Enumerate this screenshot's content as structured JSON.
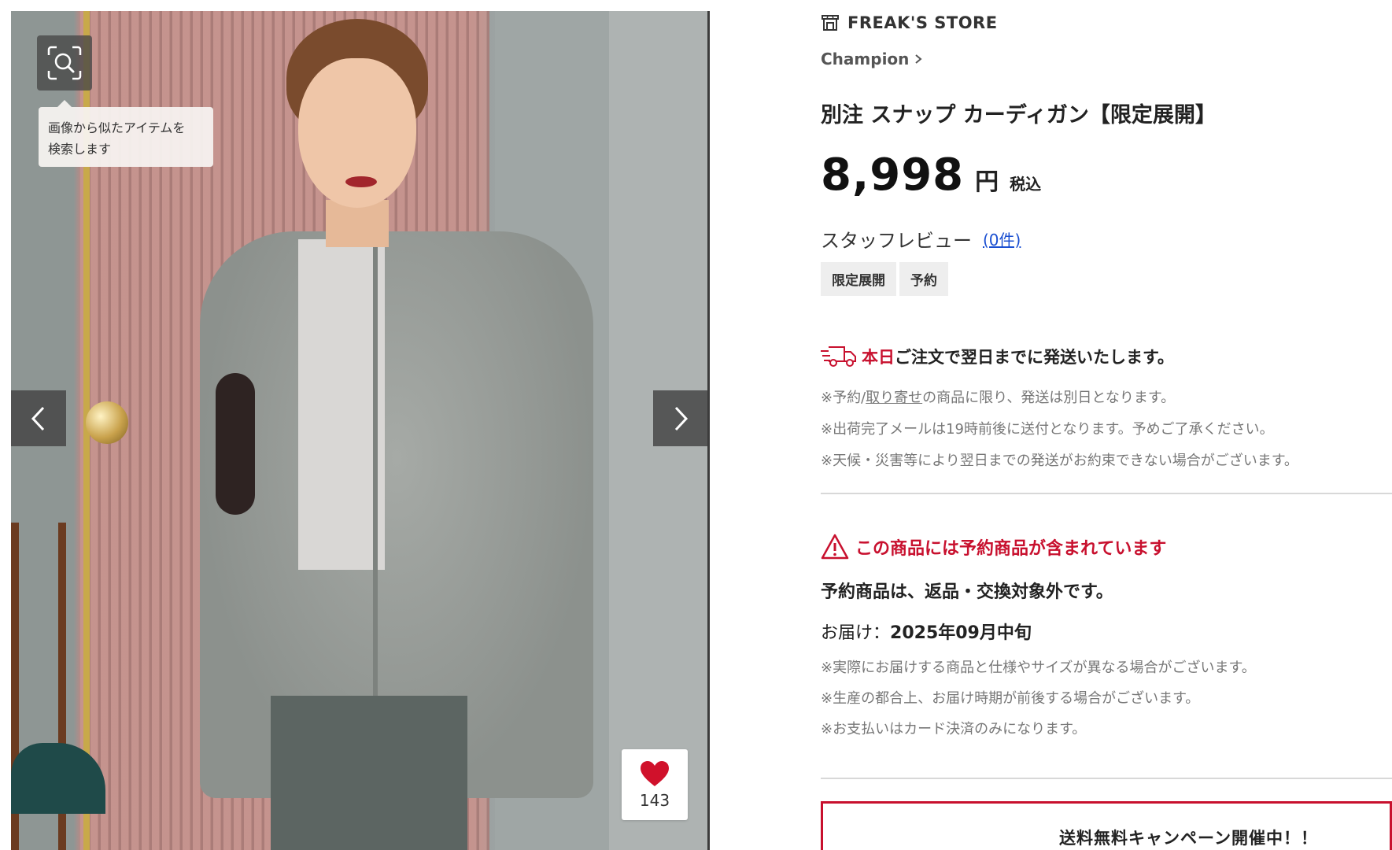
{
  "gallery": {
    "lens_tooltip_line1": "画像から似たアイテムを",
    "lens_tooltip_line2": "検索します",
    "favorite_count": "143",
    "icons": {
      "lens": "image-search-icon",
      "prev": "chevron-left-icon",
      "next": "chevron-right-icon",
      "favorite": "heart-icon"
    },
    "colors": {
      "heart": "#d0112b"
    }
  },
  "shop": {
    "name": "FREAK'S STORE",
    "icon": "store-icon"
  },
  "brand": {
    "name": "Champion",
    "icon": "chevron-right-icon"
  },
  "product": {
    "title": "別注 スナップ カーディガン【限定展開】",
    "price": "8,998",
    "currency": "円",
    "tax_label": "税込"
  },
  "review": {
    "label": "スタッフレビュー",
    "link": "(0件)"
  },
  "tags": [
    "限定展開",
    "予約"
  ],
  "shipping": {
    "icon": "delivery-truck-icon",
    "highlight": "本日",
    "rest": "ご注文で翌日までに発送いたします。",
    "notes": {
      "n1_pre": "※予約/",
      "n1_link": "取り寄せ",
      "n1_post": "の商品に限り、発送は別日となります。",
      "n2": "※出荷完了メールは19時前後に送付となります。予めご了承ください。",
      "n3": "※天候・災害等により翌日までの発送がお約束できない場合がございます。"
    }
  },
  "reservation": {
    "icon": "warning-icon",
    "warning": "この商品には予約商品が含まれています",
    "no_return": "予約商品は、返品・交換対象外です。",
    "delivery_label": "お届け：",
    "delivery_value": "2025年09月中旬",
    "notes": [
      "※実際にお届けする商品と仕様やサイズが異なる場合がございます。",
      "※生産の都合上、お届け時期が前後する場合がございます。",
      "※お支払いはカード決済のみになります。"
    ]
  },
  "campaign": {
    "text": "送料無料キャンペーン開催中！！"
  },
  "colors": {
    "accent_red": "#c8102e",
    "link_blue": "#1a4fd1",
    "note_gray": "#777777"
  }
}
